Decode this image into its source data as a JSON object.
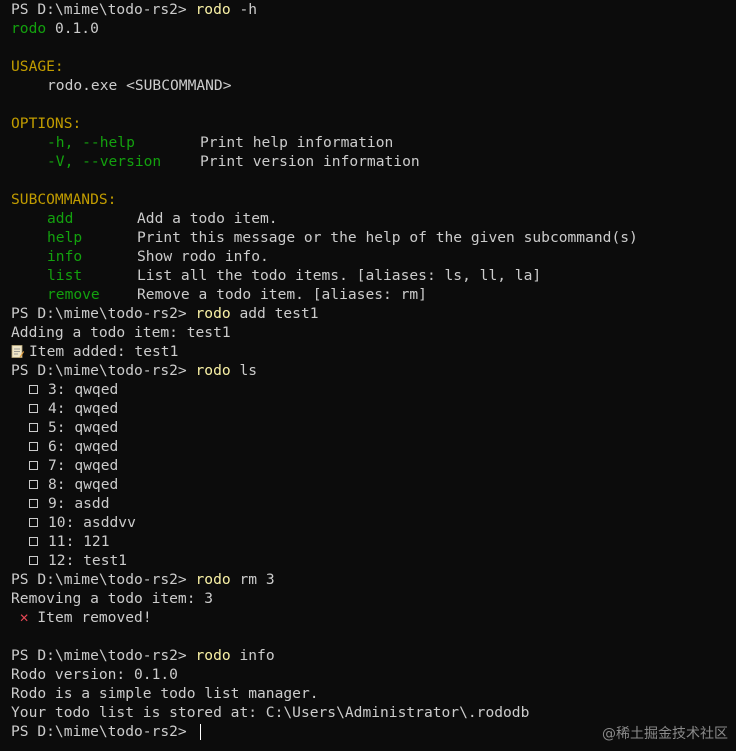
{
  "prompt": "PS D:\\mime\\todo-rs2> ",
  "cmd_help": {
    "prog": "rodo",
    "args": " -h"
  },
  "app_version_line": {
    "name": "rodo",
    "version": " 0.1.0"
  },
  "usage": {
    "heading": "USAGE:",
    "text": "rodo.exe <SUBCOMMAND>"
  },
  "options": {
    "heading": "OPTIONS:",
    "items": [
      {
        "flag": "-h, --help",
        "desc": "Print help information"
      },
      {
        "flag": "-V, --version",
        "desc": "Print version information"
      }
    ]
  },
  "subcommands": {
    "heading": "SUBCOMMANDS:",
    "items": [
      {
        "name": "add",
        "desc": "Add a todo item."
      },
      {
        "name": "help",
        "desc": "Print this message or the help of the given subcommand(s)"
      },
      {
        "name": "info",
        "desc": "Show rodo info."
      },
      {
        "name": "list",
        "desc": "List all the todo items. [aliases: ls, ll, la]"
      },
      {
        "name": "remove",
        "desc": "Remove a todo item. [aliases: rm]"
      }
    ]
  },
  "cmd_add": {
    "prog": "rodo",
    "args": " add test1"
  },
  "add_output": {
    "line1": "Adding a todo item: test1",
    "line2": "Item added: test1"
  },
  "cmd_ls": {
    "prog": "rodo",
    "args": " ls"
  },
  "todo_items": [
    "3: qwqed",
    "4: qwqed",
    "5: qwqed",
    "6: qwqed",
    "7: qwqed",
    "8: qwqed",
    "9: asdd",
    "10: asddvv",
    "11: 121",
    "12: test1"
  ],
  "cmd_rm": {
    "prog": "rodo",
    "args": " rm 3"
  },
  "rm_output": {
    "line1": "Removing a todo item: 3",
    "line2": "Item removed!"
  },
  "cmd_info": {
    "prog": "rodo",
    "args": " info"
  },
  "info_output": {
    "line1": "Rodo version: 0.1.0",
    "line2": "Rodo is a simple todo list manager.",
    "line3": "Your todo list is stored at: C:\\Users\\Administrator\\.rododb"
  },
  "watermark": "@稀土掘金技术社区",
  "colors": {
    "background": "#0c0c0c",
    "text": "#cccccc",
    "command": "#f9f1a5",
    "green": "#13a10e",
    "heading": "#c19c00",
    "error": "#e74856"
  }
}
